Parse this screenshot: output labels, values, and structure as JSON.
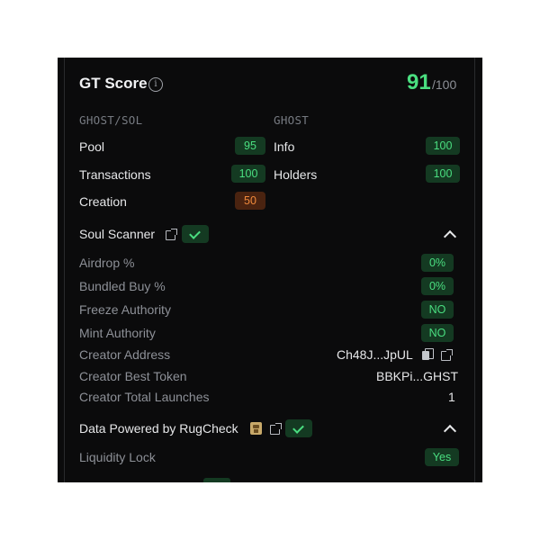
{
  "gt_score": {
    "title": "GT Score",
    "info_icon": "i",
    "score": "91",
    "max": "/100"
  },
  "pair": {
    "left_header": "GHOST/SOL",
    "right_header": "GHOST",
    "left_rows": [
      {
        "label": "Pool",
        "value": "95",
        "color": "green"
      },
      {
        "label": "Transactions",
        "value": "100",
        "color": "green"
      },
      {
        "label": "Creation",
        "value": "50",
        "color": "orange"
      }
    ],
    "right_rows": [
      {
        "label": "Info",
        "value": "100",
        "color": "green"
      },
      {
        "label": "Holders",
        "value": "100",
        "color": "green"
      }
    ]
  },
  "soul_scanner": {
    "title": "Soul Scanner",
    "rows": [
      {
        "label": "Airdrop %",
        "value": "0%"
      },
      {
        "label": "Bundled Buy %",
        "value": "0%"
      },
      {
        "label": "Freeze Authority",
        "value": "NO"
      },
      {
        "label": "Mint Authority",
        "value": "NO"
      }
    ],
    "creator_address_label": "Creator Address",
    "creator_address_value": "Ch48J...JpUL",
    "creator_best_token_label": "Creator Best Token",
    "creator_best_token_value": "BBKPi...GHST",
    "creator_total_launches_label": "Creator Total Launches",
    "creator_total_launches_value": "1"
  },
  "rugcheck": {
    "title": "Data Powered by RugCheck",
    "liquidity_lock_label": "Liquidity Lock",
    "liquidity_lock_value": "Yes"
  },
  "icons": [
    "info-icon",
    "external-link-icon",
    "check-icon",
    "chevron-up-icon",
    "copy-icon",
    "rugcheck-logo-icon"
  ],
  "colors": {
    "background": "#0b0b0c",
    "green": "#4ade80",
    "green_bg": "#143a22",
    "orange": "#f08a3c",
    "orange_bg": "#4a2310"
  }
}
